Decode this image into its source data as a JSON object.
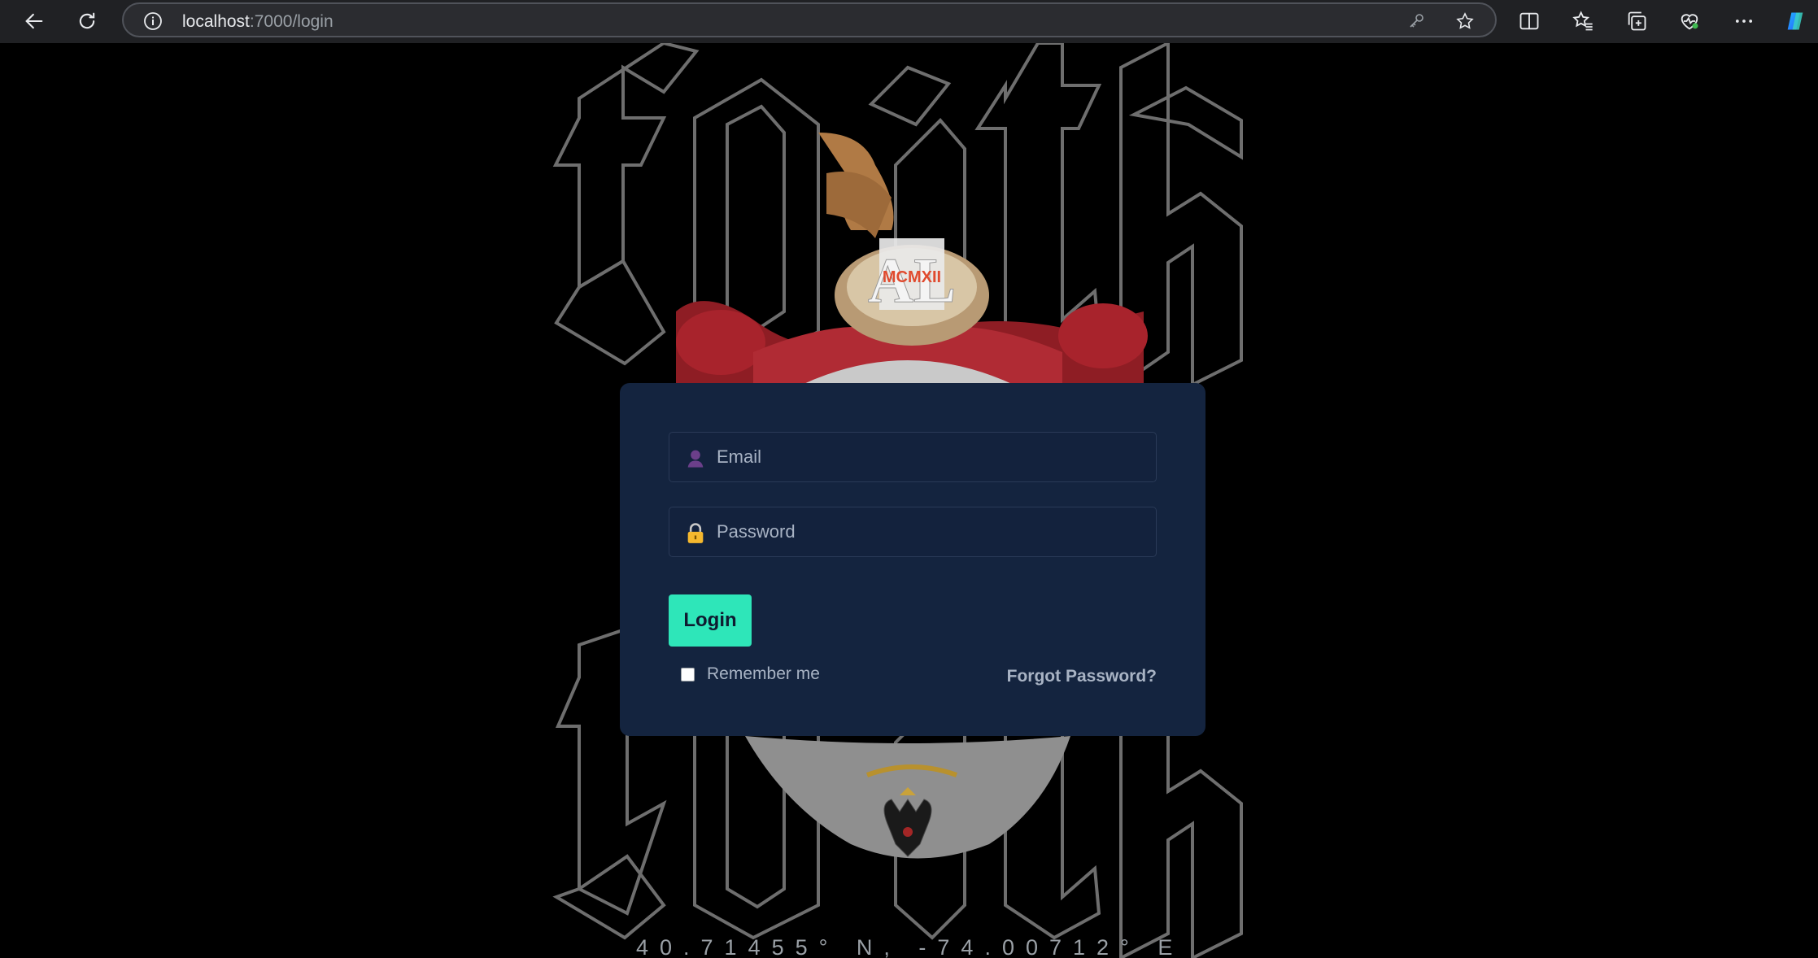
{
  "browser": {
    "url_host": "localhost",
    "url_path": ":7000/login",
    "icons": [
      "back-icon",
      "reload-icon",
      "site-info-icon",
      "key-icon",
      "star-icon",
      "split-screen-icon",
      "favorites-icon",
      "collections-icon",
      "browser-essentials-icon",
      "more-icon",
      "copilot-icon"
    ]
  },
  "background": {
    "word": "faith",
    "coordinates": "40.71455° N, -74.00712° E"
  },
  "crest": {
    "monogram": "AL",
    "year": "MCMXII"
  },
  "login": {
    "email_placeholder": "Email",
    "password_placeholder": "Password",
    "login_label": "Login",
    "remember_label": "Remember me",
    "forgot_label": "Forgot Password?",
    "colors": {
      "card": "#14243f",
      "button": "#2ee6b9",
      "user_icon": "#6b3f8a",
      "lock_icon": "#f5b82e"
    }
  }
}
